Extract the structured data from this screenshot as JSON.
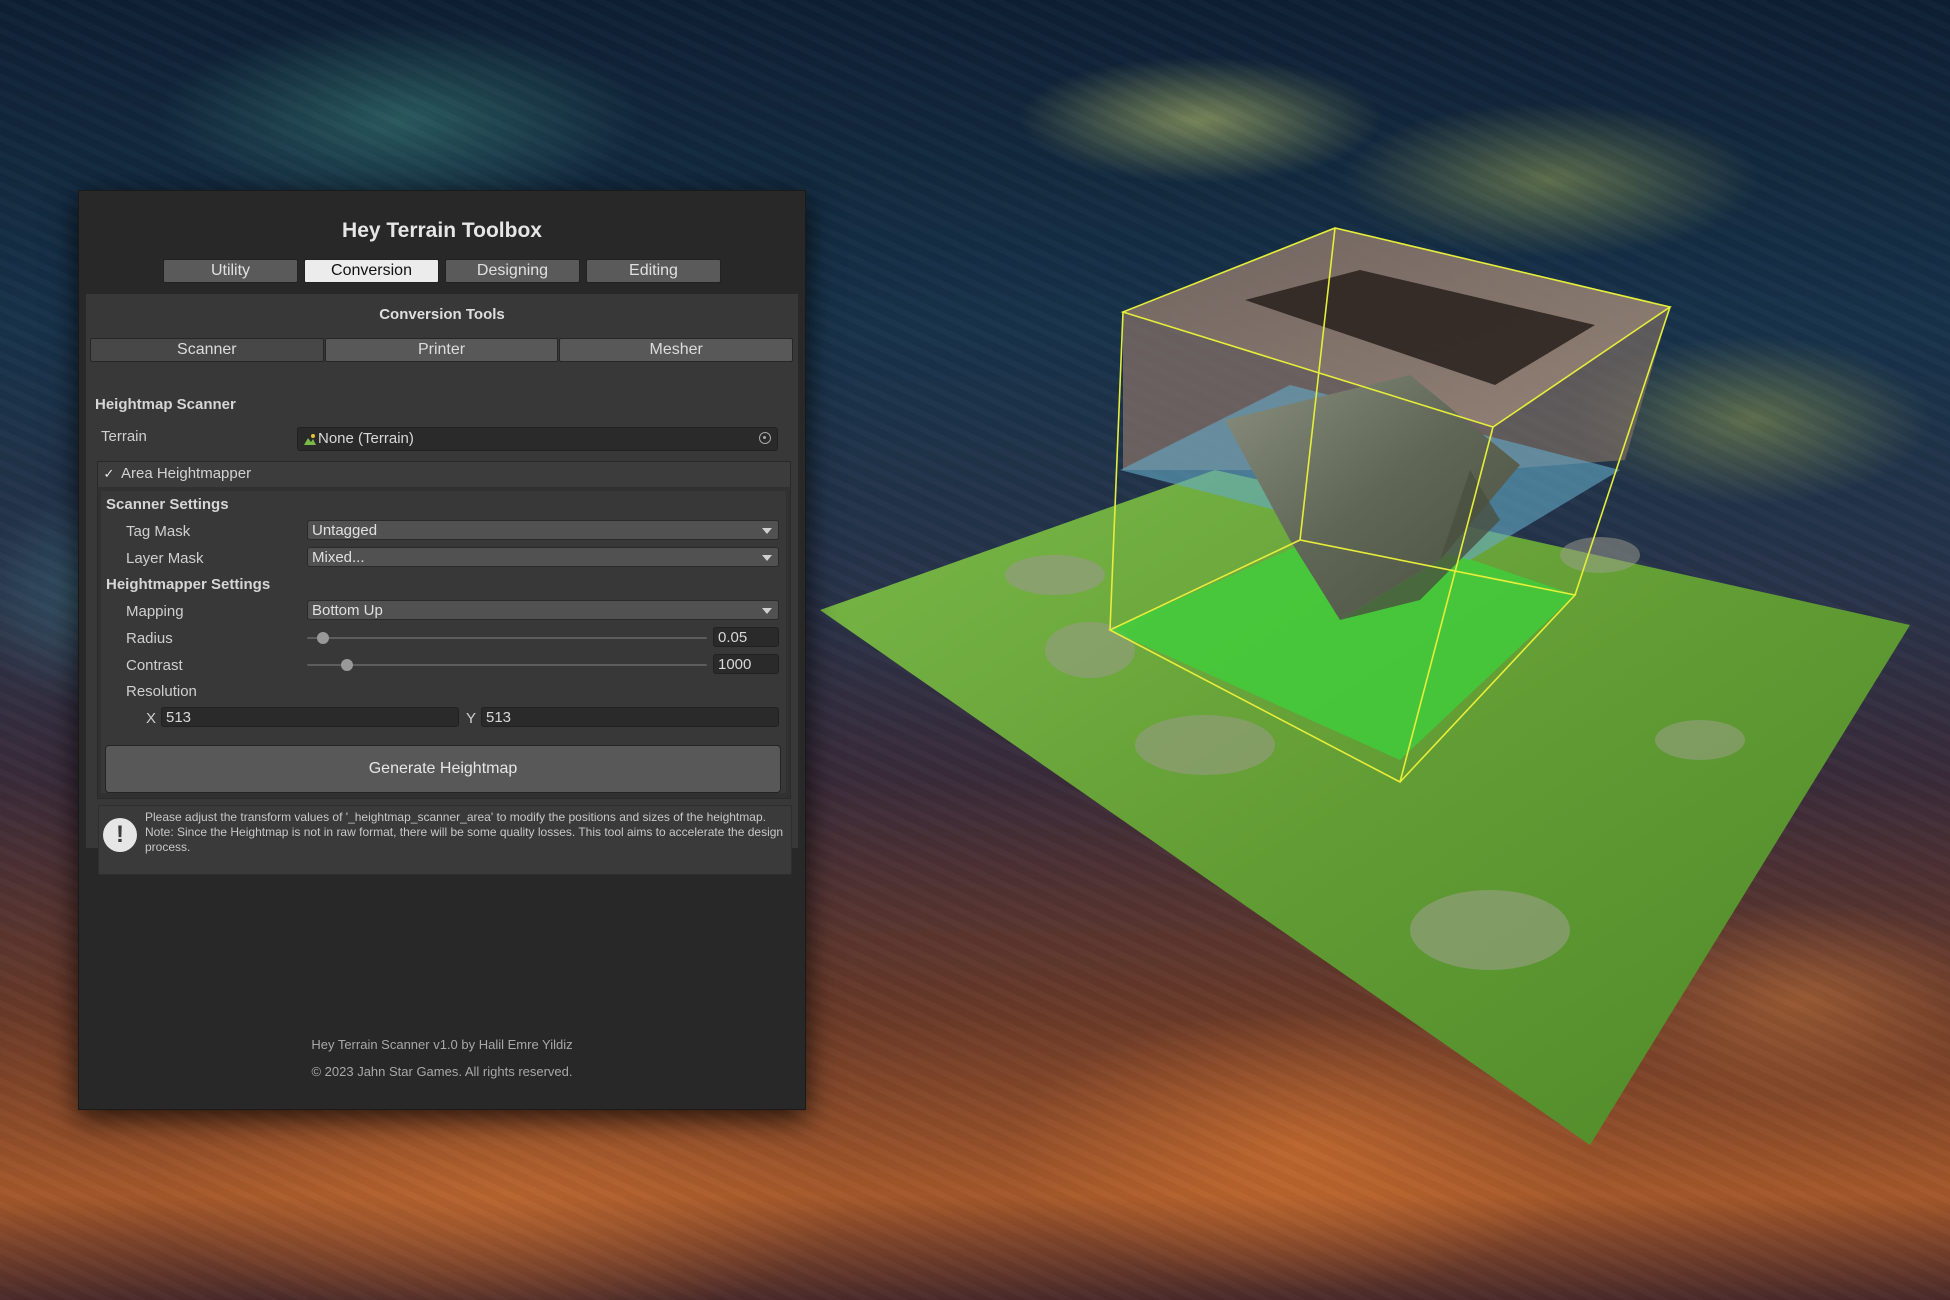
{
  "window": {
    "title": "Hey Terrain Toolbox",
    "tabs": [
      "Utility",
      "Conversion",
      "Designing",
      "Editing"
    ],
    "active_tab": "Conversion"
  },
  "panel": {
    "title": "Conversion Tools",
    "sub_tabs": [
      "Scanner",
      "Printer",
      "Mesher"
    ],
    "active_sub_tab": "Scanner"
  },
  "scanner": {
    "heading": "Heightmap Scanner",
    "terrain_label": "Terrain",
    "terrain_value": "None (Terrain)",
    "area_toggle_label": "Area Heightmapper",
    "area_checkbox": "✓",
    "scanner_settings": "Scanner Settings",
    "tag_mask_label": "Tag Mask",
    "tag_mask_value": "Untagged",
    "layer_mask_label": "Layer Mask",
    "layer_mask_value": "Mixed...",
    "heightmapper_settings": "Heightmapper Settings",
    "mapping_label": "Mapping",
    "mapping_value": "Bottom Up",
    "radius_label": "Radius",
    "radius_value": "0.05",
    "radius_fraction": 0.04,
    "contrast_label": "Contrast",
    "contrast_value": "1000",
    "contrast_fraction": 0.1,
    "resolution_label": "Resolution",
    "res_x_label": "X",
    "res_x_value": "513",
    "res_y_label": "Y",
    "res_y_value": "513",
    "generate_label": "Generate Heightmap"
  },
  "help": {
    "icon": "!",
    "line1": "Please adjust the transform values of '_heightmap_scanner_area' to modify the positions and sizes of the heightmap.",
    "line2": "Note: Since the Heightmap is not in raw format, there will be some quality losses. This tool aims to accelerate the design process."
  },
  "footer": {
    "credit": "Hey Terrain Scanner v1.0 by Halil Emre Yildiz",
    "copyright": "© 2023 Jahn Star Games. All rights reserved."
  },
  "colors": {
    "bounds_yellow": "#e6ee3a",
    "terrain_green": "#6aa63a",
    "scan_green": "#3cd23c",
    "water_blue": "#64aac8"
  }
}
